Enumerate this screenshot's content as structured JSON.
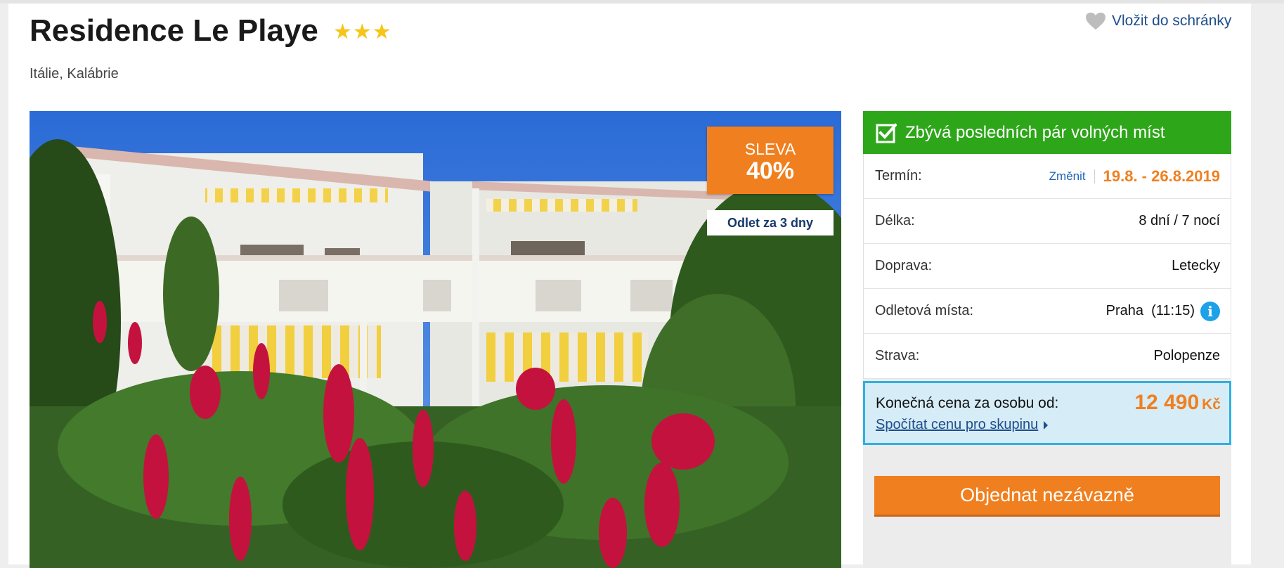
{
  "hotel": {
    "name": "Residence Le Playe",
    "stars": "★★★",
    "location": "Itálie, Kalábrie"
  },
  "wishlist": {
    "label": "Vložit do schránky",
    "icon": "heart-icon"
  },
  "photo": {
    "sale_label": "SLEVA",
    "sale_percent": "40%",
    "departure_note": "Odlet za 3 dny"
  },
  "availability": {
    "text": "Zbývá posledních pár volných míst",
    "icon": "checkbox-icon"
  },
  "details": {
    "term": {
      "label": "Termín:",
      "change_link": "Změnit",
      "value": "19.8. - 26.8.2019"
    },
    "length": {
      "label": "Délka:",
      "value": "8 dní / 7 nocí"
    },
    "transport": {
      "label": "Doprava:",
      "value": "Letecky"
    },
    "departures": {
      "label": "Odletová místa:",
      "value": "Praha  (11:15)"
    },
    "board": {
      "label": "Strava:",
      "value": "Polopenze"
    }
  },
  "price": {
    "label": "Konečná cena za osobu od:",
    "amount": "12 490",
    "currency": "Kč",
    "group_link": "Spočítat cenu pro skupinu"
  },
  "order_button": "Objednat nezávazně",
  "colors": {
    "accent_orange": "#f07f1f",
    "success_green": "#2ea61a",
    "link_blue": "#1c4d8c",
    "info_blue": "#1da1e8",
    "price_box_bg": "#d6ecf6",
    "stars": "#f5c518"
  }
}
